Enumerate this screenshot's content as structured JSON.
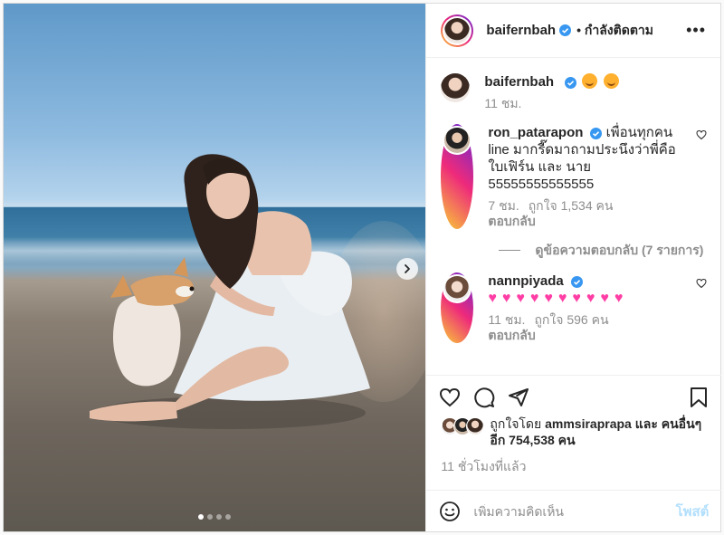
{
  "colors": {
    "accent": "#0095f6",
    "post_disabled": "#b2dffc",
    "heart_emoji": "#ff3ea5",
    "verified": "#3897f0"
  },
  "photo": {
    "carousel_total": 4,
    "carousel_active": 1
  },
  "header": {
    "username": "baifernbah",
    "separator": "•",
    "follow_status": "กำลังติดตาม",
    "more_label": "•••"
  },
  "caption": {
    "username": "baifernbah",
    "emojis": [
      "smiling-face",
      "smiling-face"
    ],
    "time": "11 ชม."
  },
  "comments": [
    {
      "username": "ron_patarapon",
      "text": "เพื่อนทุกคน line มากรี๊ดมาถามประนึงว่าพี่คือ ใบเฟิร์น และ นาย 55555555555555",
      "time": "7 ชม.",
      "likes": "ถูกใจ 1,534 คน",
      "reply": "ตอบกลับ",
      "view_replies": "ดูข้อความตอบกลับ (7 รายการ)"
    },
    {
      "username": "nannpiyada",
      "hearts": [
        "💗",
        "💗",
        "💗",
        "💗",
        "💗",
        "💗",
        "💗",
        "💗",
        "💗",
        "💗"
      ],
      "time": "11 ชม.",
      "likes": "ถูกใจ 596 คน",
      "reply": "ตอบกลับ"
    }
  ],
  "liked_by": {
    "prefix": "ถูกใจโดย",
    "user": "ammsiraprapa",
    "and": "และ",
    "others": "คนอื่นๆ อีก 754,538 คน"
  },
  "post_time": "11 ชั่วโมงที่แล้ว",
  "add_comment": {
    "placeholder": "เพิ่มความคิดเห็น",
    "post_label": "โพสต์"
  }
}
